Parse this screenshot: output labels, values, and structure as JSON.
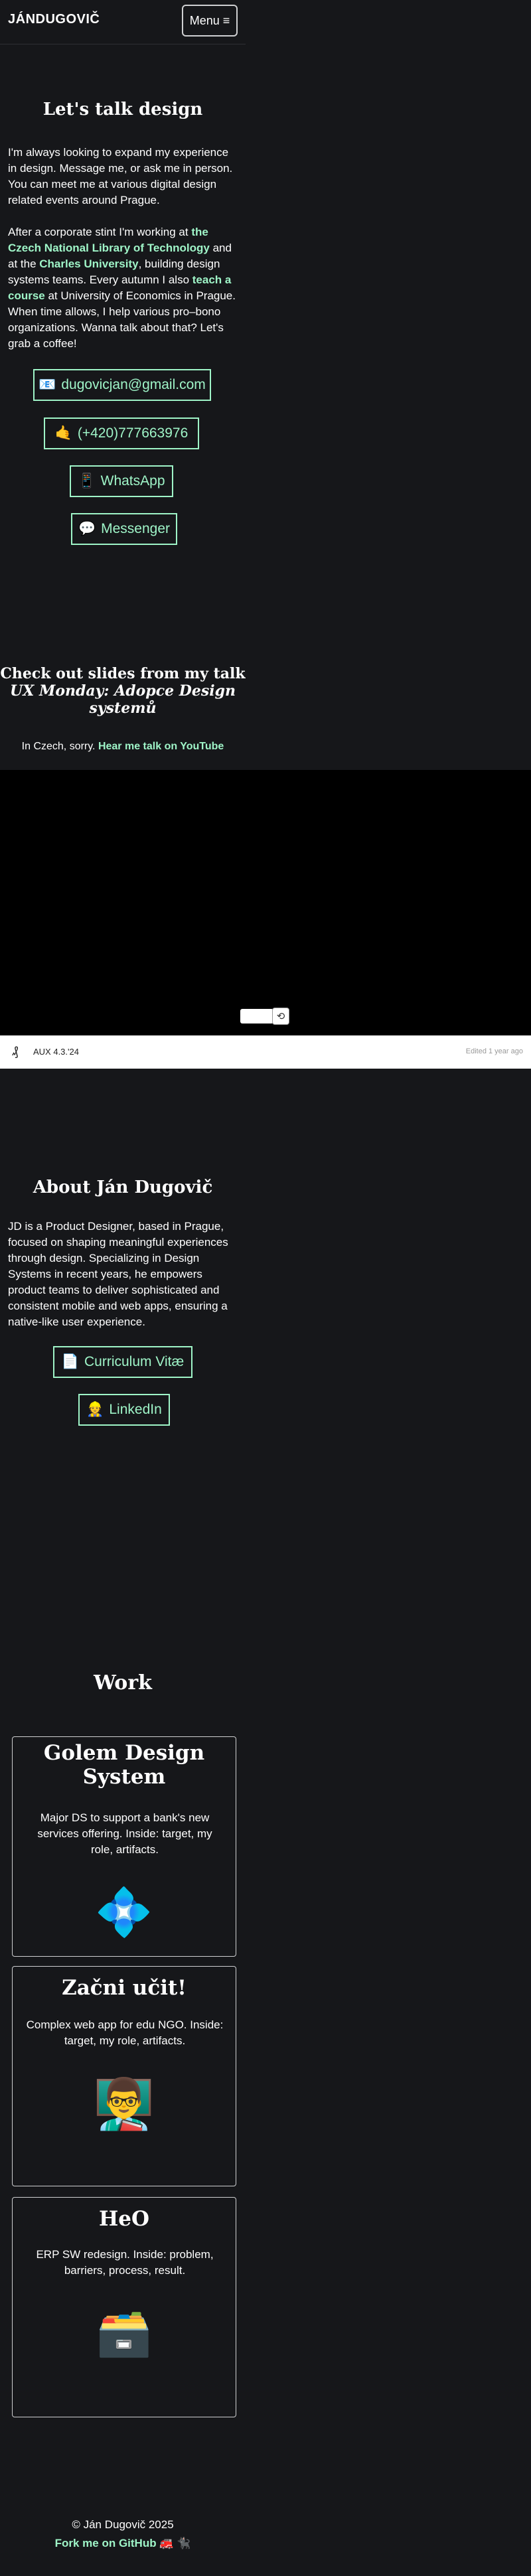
{
  "header": {
    "logo": "JÁNDUGOVIČ",
    "menu_label": "Menu ≡"
  },
  "contact": {
    "title": "Let's talk design",
    "intro": "I'm always looking to expand my experience in design. Message me, or ask me in person. You can meet me at various digital design related events around Prague.",
    "p2": {
      "t1": "After a corporate stint I'm working at ",
      "link1": "the Czech National Library of Technology",
      "t2": " and at the ",
      "link2": "Charles University",
      "t3": ", building design systems teams. Every autumn I also ",
      "link3": "teach a course",
      "t4": " at University of Economics in Prague. When time allows, I help various pro–bono organizations.    Wanna talk about that? Let's grab a coffee!"
    },
    "buttons": [
      {
        "icon": "📧",
        "label": "dugovicjan@gmail.com"
      },
      {
        "icon": "🤙",
        "label": "(+420)777663976"
      },
      {
        "icon": "📱",
        "label": "WhatsApp"
      },
      {
        "icon": "💬",
        "label": "Messenger"
      }
    ]
  },
  "slides": {
    "title_line1": "Check out slides from my talk",
    "title_line2": "UX Monday: Adopce Design systemů",
    "note_text": "In Czech, sorry. ",
    "note_link": "Hear me talk on YouTube",
    "embed_logo": "₰",
    "embed_title": "AUX 4.3.'24",
    "embed_meta": "Edited 1 year ago",
    "replay_icon": "⟲"
  },
  "about": {
    "title": "About Ján Dugovič",
    "text": "JD is a Product Designer, based in Prague, focused on shaping meaningful experiences through design. Specializing in Design Systems in recent years, he empowers product teams to deliver sophisticated and consistent mobile and web apps, ensuring a native-like user experience.",
    "buttons": [
      {
        "icon": "📄",
        "label": "Curriculum Vitæ"
      },
      {
        "icon": "👷",
        "label": "LinkedIn"
      }
    ]
  },
  "work": {
    "title": "Work",
    "cards": [
      {
        "title": "Golem Design System",
        "desc": "Major DS to support a bank's new services offering. Inside: target, my role, artifacts.",
        "icon": "💠"
      },
      {
        "title": "Začni učit!",
        "desc": "Complex web app for edu NGO. Inside: target, my role, artifacts.",
        "icon": "👨‍🏫"
      },
      {
        "title": "HeO",
        "desc": "ERP SW redesign. Inside: problem, barriers, process, result.",
        "icon": "🗃️"
      }
    ]
  },
  "footer": {
    "copyright": "© Ján Dugovič 2025",
    "github": "Fork me on GitHub",
    "emoji": "🚒 🐈‍⬛"
  },
  "colors": {
    "background": "#16171a",
    "accent": "#9ff5c8",
    "text": "#ffffff"
  }
}
